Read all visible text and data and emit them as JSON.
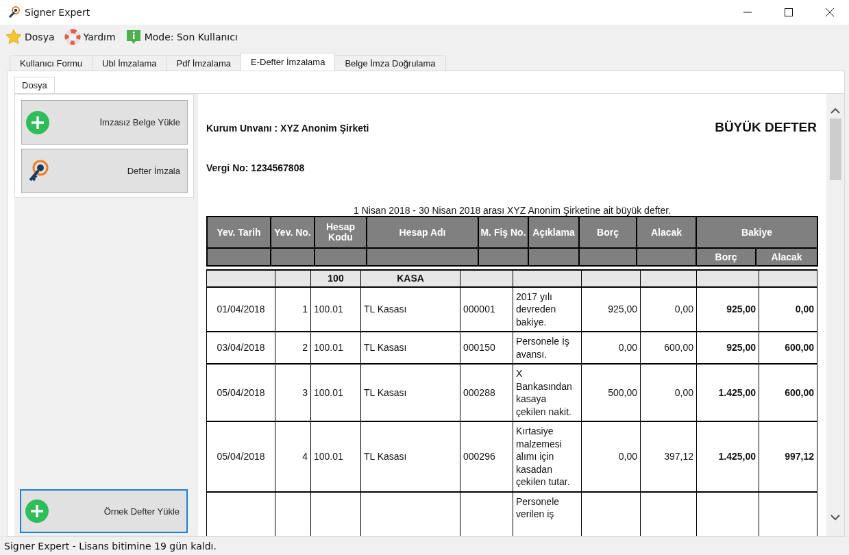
{
  "window": {
    "title": "Signer Expert"
  },
  "menu": [
    {
      "kind": "star",
      "label": "Dosya"
    },
    {
      "kind": "lifebuoy",
      "label": "Yardım"
    },
    {
      "kind": "info",
      "label": "Mode: Son Kullanıcı"
    }
  ],
  "tabs": [
    {
      "label": "Kullanıcı Formu",
      "selected": false
    },
    {
      "label": "Ubl İmzalama",
      "selected": false
    },
    {
      "label": "Pdf İmzalama",
      "selected": false
    },
    {
      "label": "E-Defter İmzalama",
      "selected": true
    },
    {
      "label": "Belge İmza Doğrulama",
      "selected": false
    }
  ],
  "subtabs": [
    {
      "label": "Dosya",
      "selected": true
    }
  ],
  "actions": [
    {
      "kind": "plus",
      "label": "İmzasız Belge Yükle",
      "focused": false
    },
    {
      "kind": "key",
      "label": "Defter İmzala",
      "focused": false
    }
  ],
  "bottom_action": {
    "kind": "plus",
    "label": "Örnek Defter Yükle",
    "focused": true
  },
  "document": {
    "company": "Kurum Unvanı : XYZ Anonim Şirketi",
    "title": "BÜYÜK DEFTER",
    "tax_no": "Vergi No: 1234567808",
    "caption": "1 Nisan 2018 - 30 Nisan 2018 arası XYZ Anonim Şirketine ait büyük defter.",
    "columns": [
      "Yev. Tarih",
      "Yev. No.",
      "Hesap Kodu",
      "Hesap Adı",
      "M. Fiş No.",
      "Açıklama",
      "Borç",
      "Alacak",
      "Bakiye"
    ],
    "subcolumns": [
      "Borç",
      "Alacak"
    ],
    "group": {
      "code": "100",
      "name": "KASA"
    },
    "rows": [
      {
        "date": "01/04/2018",
        "no": "1",
        "code": "100.01",
        "name": "TL Kasası",
        "voucher": "000001",
        "description": "2017 yılı devreden bakiye.",
        "debit": "925,00",
        "credit": "0,00",
        "balance_debit": "925,00",
        "balance_credit": "0,00"
      },
      {
        "date": "03/04/2018",
        "no": "2",
        "code": "100.01",
        "name": "TL Kasası",
        "voucher": "000150",
        "description": "Personele İş avansı.",
        "debit": "0,00",
        "credit": "600,00",
        "balance_debit": "925,00",
        "balance_credit": "600,00"
      },
      {
        "date": "05/04/2018",
        "no": "3",
        "code": "100.01",
        "name": "TL Kasası",
        "voucher": "000288",
        "description": "X Bankasından kasaya çekilen nakit.",
        "debit": "500,00",
        "credit": "0,00",
        "balance_debit": "1.425,00",
        "balance_credit": "600,00"
      },
      {
        "date": "05/04/2018",
        "no": "4",
        "code": "100.01",
        "name": "TL Kasası",
        "voucher": "000296",
        "description": "Kırtasiye malzemesi alımı için kasadan çekilen tutar.",
        "debit": "0,00",
        "credit": "397,12",
        "balance_debit": "1.425,00",
        "balance_credit": "997,12"
      },
      {
        "description": "Personele verilen iş"
      }
    ]
  },
  "status_bar": {
    "text": "Signer Expert - Lisans bitimine 19 gün kaldı."
  }
}
